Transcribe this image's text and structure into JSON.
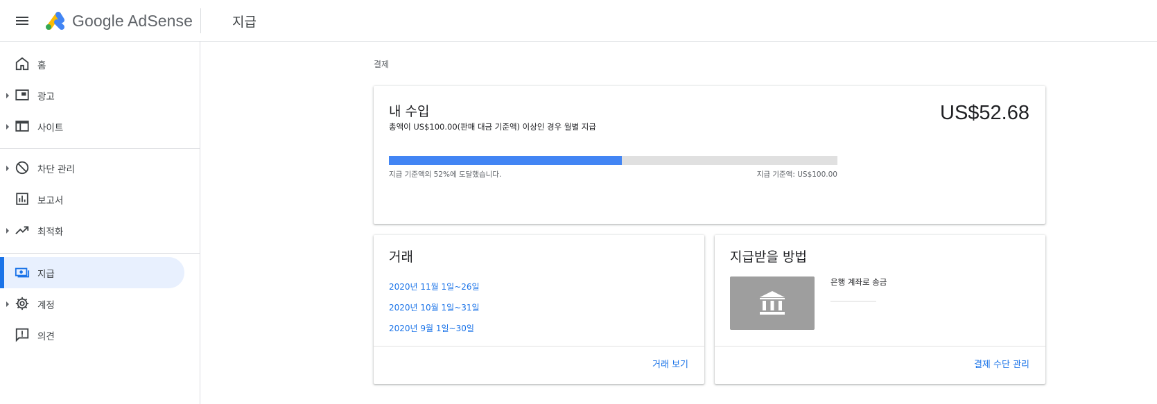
{
  "app": {
    "brand": "Google AdSense",
    "page_title": "지급"
  },
  "sidebar": {
    "items": [
      {
        "label": "홈",
        "icon": "home-icon"
      },
      {
        "label": "광고",
        "icon": "ad-unit-icon"
      },
      {
        "label": "사이트",
        "icon": "web-icon"
      },
      {
        "label": "차단 관리",
        "icon": "block-icon"
      },
      {
        "label": "보고서",
        "icon": "report-chart-icon"
      },
      {
        "label": "최적화",
        "icon": "trending-up-icon"
      },
      {
        "label": "지급",
        "icon": "payments-icon",
        "active": true
      },
      {
        "label": "계정",
        "icon": "gear-icon"
      },
      {
        "label": "의견",
        "icon": "feedback-icon"
      }
    ]
  },
  "main": {
    "breadcrumb": "결제",
    "earnings": {
      "title": "내 수입",
      "subtitle": "총액이 US$100.00(판매 대금 기준액) 이상인 경우 월별 지급",
      "amount": "US$52.68",
      "progress_fraction": 0.52,
      "progress_text": "지급 기준액의 52%에 도달했습니다.",
      "threshold_text": "지급 기준액: US$100.00"
    },
    "transactions": {
      "title": "거래",
      "links": [
        "2020년 11월 1일~26일",
        "2020년 10월 1일~31일",
        "2020년 9월 1일~30일"
      ],
      "footer_link": "거래 보기"
    },
    "payment_method": {
      "title": "지급받을 방법",
      "method": "은행 계좌로 송금",
      "footer_link": "결제 수단 관리"
    }
  },
  "colors": {
    "accent": "#1a73e8",
    "progress": "#4285f4",
    "active_bg": "#e8f0fe"
  }
}
